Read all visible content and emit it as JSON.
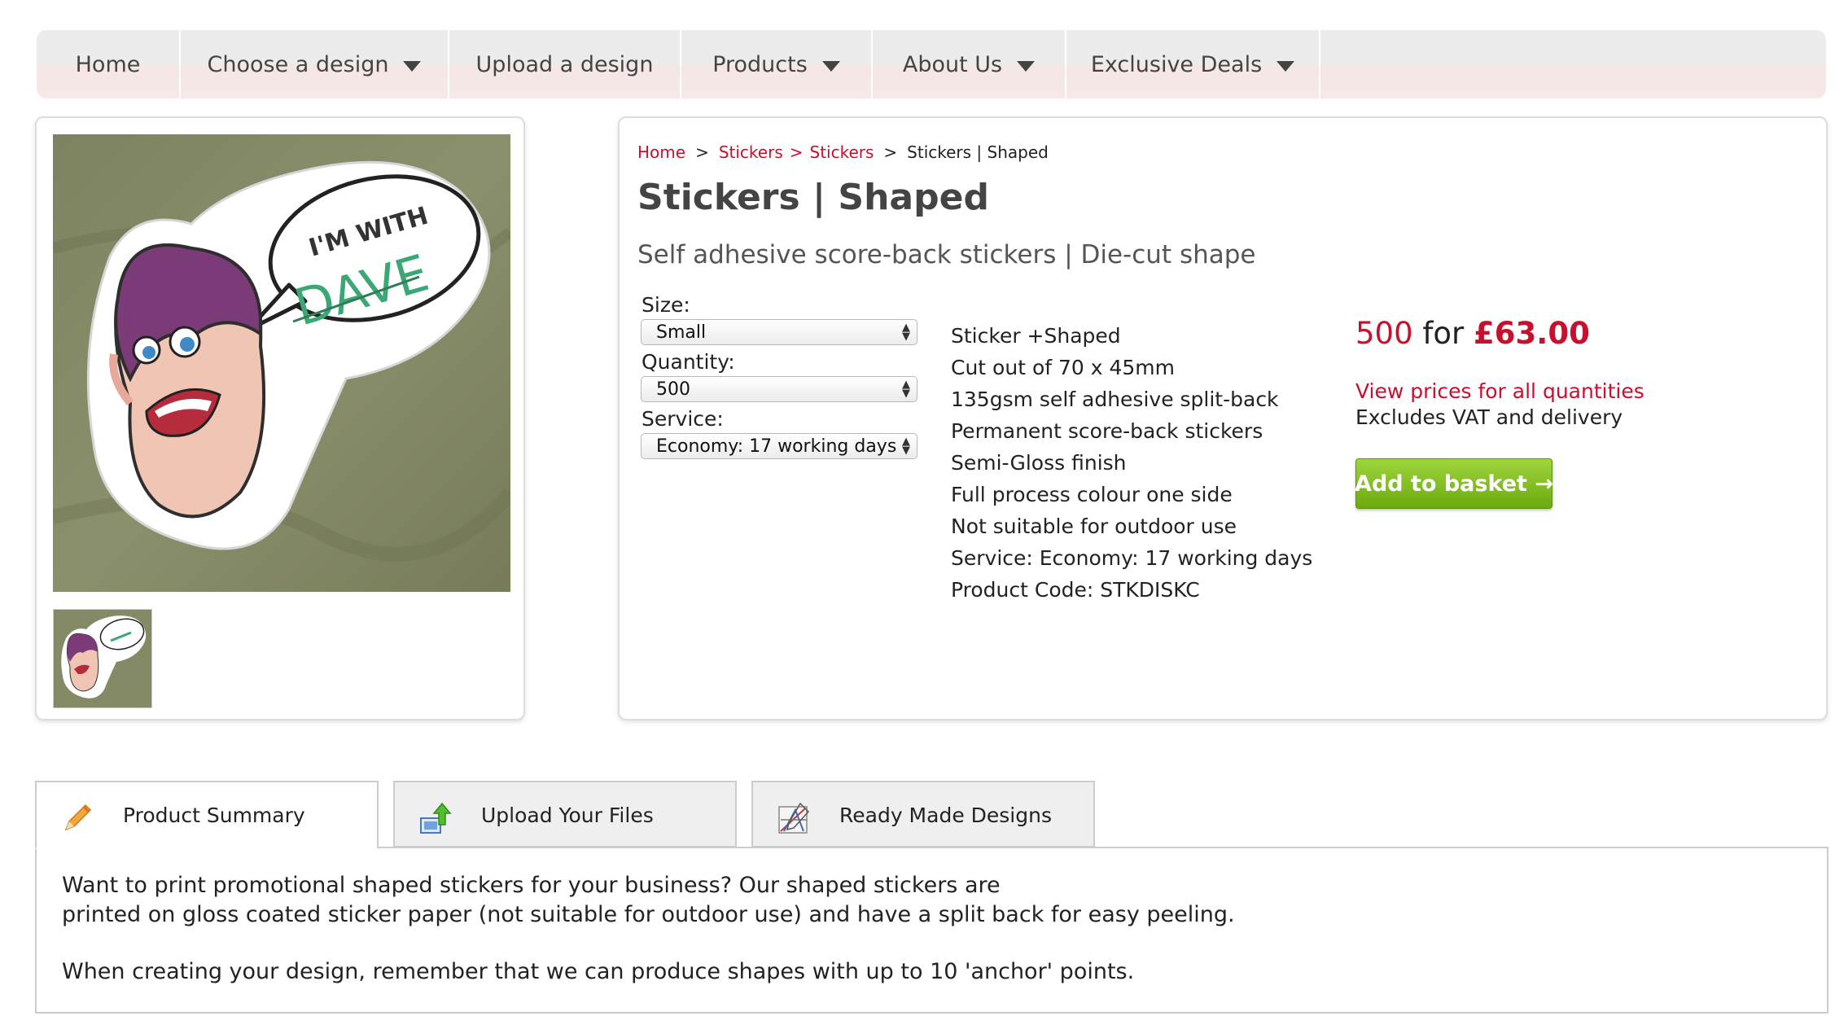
{
  "nav": {
    "items": [
      {
        "label": "Home",
        "dropdown": false
      },
      {
        "label": "Choose a design",
        "dropdown": true
      },
      {
        "label": "Upload a design",
        "dropdown": false
      },
      {
        "label": "Products",
        "dropdown": true
      },
      {
        "label": "About Us",
        "dropdown": true
      },
      {
        "label": "Exclusive Deals",
        "dropdown": true
      }
    ]
  },
  "gallery": {
    "speech_text_top": "I'M WITH",
    "speech_text_name": "DAVE"
  },
  "breadcrumb": {
    "home": "Home",
    "cat1": "Stickers",
    "cat2": "Stickers",
    "current": "Stickers | Shaped",
    "sep": ">"
  },
  "product": {
    "title": "Stickers | Shaped",
    "subtitle": "Self adhesive score-back stickers | Die-cut shape"
  },
  "options": {
    "size_label": "Size:",
    "size_value": "Small",
    "quantity_label": "Quantity:",
    "quantity_value": "500",
    "service_label": "Service:",
    "service_value": "Economy: 17 working days"
  },
  "specs": [
    "Sticker +Shaped",
    "Cut out of 70 x 45mm",
    "135gsm self adhesive split-back",
    "Permanent score-back stickers",
    "Semi-Gloss finish",
    "Full process colour one side",
    "Not suitable for outdoor use",
    "Service: Economy: 17 working days",
    "Product Code: STKDISKC"
  ],
  "pricing": {
    "qty": "500",
    "for_word": "for",
    "price": "£63.00",
    "view_all": "View prices for all quantities",
    "vat_note": "Excludes VAT and delivery",
    "basket_label": "Add to basket →"
  },
  "tabs": [
    {
      "label": "Product Summary",
      "icon": "pencil-icon"
    },
    {
      "label": "Upload Your Files",
      "icon": "upload-icon"
    },
    {
      "label": "Ready Made Designs",
      "icon": "design-tools-icon"
    }
  ],
  "summary": {
    "line1": "Want to print promotional shaped stickers for your business? Our shaped stickers are",
    "line2": "printed on gloss coated sticker paper (not suitable for outdoor use) and have a split back for easy peeling.",
    "line3": "When creating your design, remember that we can produce shapes with up to 10 'anchor' points."
  },
  "colors": {
    "brand_red": "#c8102e",
    "basket_green": "#7dbb1a",
    "fabric": "#858a66"
  }
}
